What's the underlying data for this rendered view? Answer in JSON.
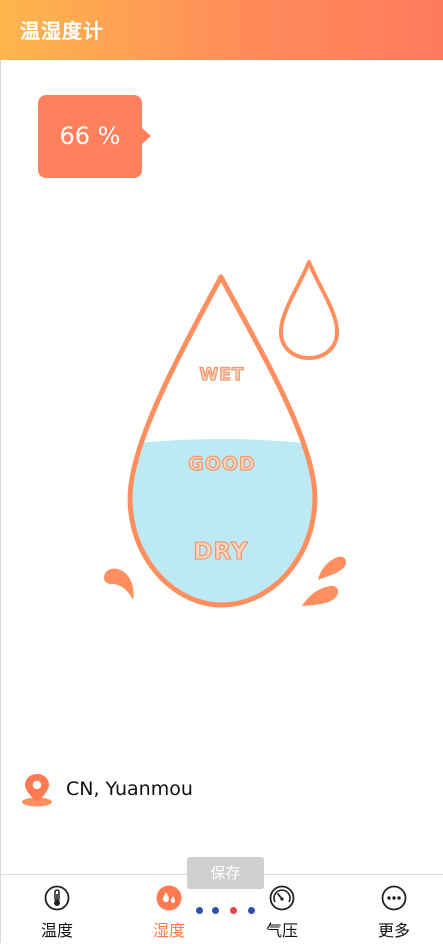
{
  "header": {
    "title": "温湿度计"
  },
  "humidity": {
    "value_text": "66 %",
    "value": 66
  },
  "gauge": {
    "labels": {
      "wet": "WET",
      "good": "GOOD",
      "dry": "DRY"
    },
    "fill_level": 0.5
  },
  "location": {
    "icon": "location-pin-icon",
    "text": "CN, Yuanmou"
  },
  "save_button": {
    "label": "保存"
  },
  "nav": {
    "items": [
      {
        "label": "温度",
        "icon": "thermometer-icon",
        "active": false
      },
      {
        "label": "湿度",
        "icon": "water-drop-icon",
        "active": true
      },
      {
        "label": "气压",
        "icon": "gauge-icon",
        "active": false
      },
      {
        "label": "更多",
        "icon": "more-icon",
        "active": false
      }
    ]
  },
  "pager": {
    "count": 4,
    "active_index": 2
  },
  "colors": {
    "header_start": "#fdb64c",
    "header_end": "#ff7a5c",
    "accent": "#ff805b",
    "drop_outline": "#ff8f5f",
    "water": "#bde9f4",
    "active_nav": "#ff7a52",
    "dot": "#2f4fa8",
    "dot_active": "#e8434b"
  }
}
